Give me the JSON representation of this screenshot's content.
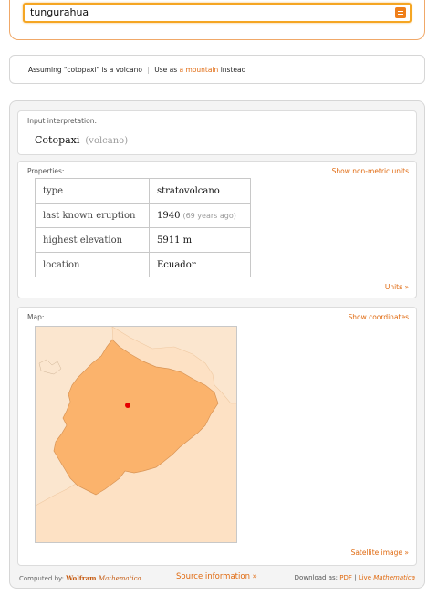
{
  "search": {
    "value": "tungurahua"
  },
  "assumption": {
    "prefix": "Assuming \"cotopaxi\" is a volcano",
    "separator": "|",
    "use_as_text": "Use as",
    "alt_link": "a mountain",
    "suffix": "instead"
  },
  "interpretation": {
    "title": "Input interpretation:",
    "main": "Cotopaxi",
    "sub": "(volcano)"
  },
  "properties": {
    "title": "Properties:",
    "toggle_link": "Show non-metric units",
    "units_link": "Units »",
    "rows": [
      {
        "key": "type",
        "value": "stratovolcano",
        "note": ""
      },
      {
        "key": "last known eruption",
        "value": "1940",
        "note": "(69 years ago)"
      },
      {
        "key": "highest elevation",
        "value": "5911 m",
        "note": ""
      },
      {
        "key": "location",
        "value": "Ecuador",
        "note": ""
      }
    ]
  },
  "map": {
    "title": "Map:",
    "coords_link": "Show coordinates",
    "satellite_link": "Satellite image »",
    "colors": {
      "country": "#fbb36c",
      "neighbor": "#fbe6cf",
      "marker": "#e60000"
    }
  },
  "footer": {
    "computed_by": "Computed by:",
    "brand_1": "Wolfram",
    "brand_2": "Mathematica",
    "source_link": "Source information »",
    "download_as": "Download as:",
    "pdf": "PDF",
    "sep": "|",
    "live": "Live",
    "live_2": "Mathematica"
  }
}
